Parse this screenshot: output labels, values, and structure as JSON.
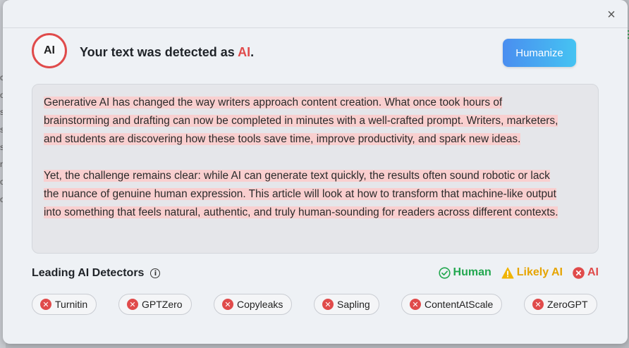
{
  "colors": {
    "ai": "#e04b4b",
    "human": "#22a74f",
    "likely_ai": "#e6a400",
    "highlight": "#f9cfcf",
    "button_start": "#4a8ef0",
    "button_end": "#45c3f2"
  },
  "backdrop": {
    "letters": [
      "c",
      "o",
      "s",
      "s",
      "s",
      "n",
      "c",
      "o"
    ]
  },
  "modal": {
    "close_icon": "close-icon",
    "close_glyph": "×"
  },
  "result": {
    "badge": "AI",
    "prefix": "Your text was detected as ",
    "verdict": "AI",
    "suffix": ".",
    "humanize_label": "Humanize"
  },
  "analyzed_text": {
    "paragraphs": [
      [
        "Generative AI has changed the way writers approach content creation. What once took hours of",
        "brainstorming and drafting can now be completed in minutes with a well-crafted prompt. Writers, marketers,",
        "and students are discovering how these tools save time, improve productivity, and spark new ideas."
      ],
      [
        "Yet, the challenge remains clear: while AI can generate text quickly, the results often sound robotic or lack",
        "the nuance of genuine human expression. This article will look at how to transform that machine-like output",
        "into something that feels natural, authentic, and truly human-sounding for readers across different contexts."
      ]
    ]
  },
  "detectors": {
    "title": "Leading AI Detectors",
    "info_icon": "info-icon",
    "legend": [
      {
        "label": "Human",
        "icon": "check-circle-icon",
        "color": "#22a74f"
      },
      {
        "label": "Likely AI",
        "icon": "warning-icon",
        "color": "#e6a400"
      },
      {
        "label": "AI",
        "icon": "x-circle-icon",
        "color": "#e04b4b"
      }
    ],
    "items": [
      {
        "name": "Turnitin",
        "status": "AI"
      },
      {
        "name": "GPTZero",
        "status": "AI"
      },
      {
        "name": "Copyleaks",
        "status": "AI"
      },
      {
        "name": "Sapling",
        "status": "AI"
      },
      {
        "name": "ContentAtScale",
        "status": "AI"
      },
      {
        "name": "ZeroGPT",
        "status": "AI"
      }
    ]
  }
}
